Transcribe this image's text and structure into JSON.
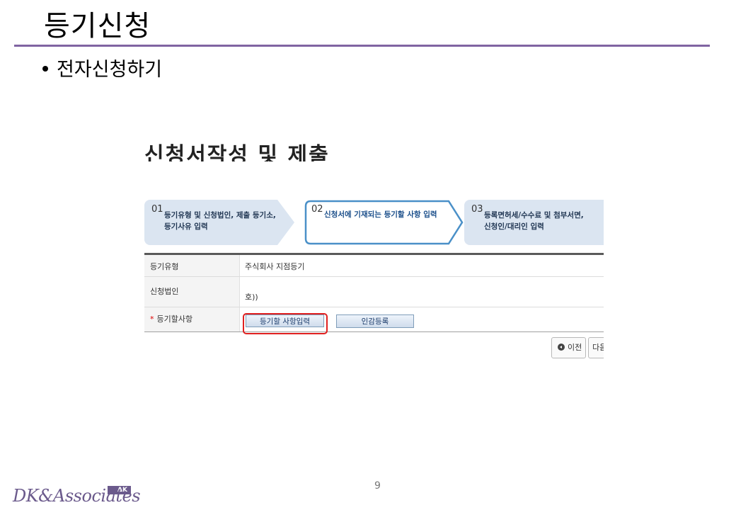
{
  "slide": {
    "title": "등기신청",
    "bullet": "전자신청하기",
    "page_number": "9"
  },
  "screenshot": {
    "title": "신청서작성 및 제출",
    "steps": [
      {
        "number": "01",
        "line1": "등기유형 및 신청법인, 제출 등기소,",
        "line2": "등기사유 입력"
      },
      {
        "number": "02",
        "line1": "신청서에 기재되는 등기할 사항 입력",
        "line2": ""
      },
      {
        "number": "03",
        "line1": "등록면허세/수수료 및 첨부서면,",
        "line2": "신청인/대리인 입력"
      }
    ],
    "form": {
      "rows": [
        {
          "label": "등기유형",
          "value": "주식회사 지점등기"
        },
        {
          "label": "신청법인",
          "value": "호))"
        },
        {
          "label": "등기할사항",
          "required_mark": "*"
        }
      ],
      "input_button_label": "등기할 사항입력",
      "seal_button_label": "인감등록"
    },
    "nav": {
      "prev_label": "이전",
      "next_label": "다음"
    }
  },
  "footer": {
    "logo_text": "DK&Associates",
    "logo_mark": "ΔK"
  },
  "colors": {
    "title_rule": "#8064a2",
    "step_fill": "#dbe5f1",
    "active_step_outline": "#4a90c8",
    "highlight": "#e02020"
  }
}
